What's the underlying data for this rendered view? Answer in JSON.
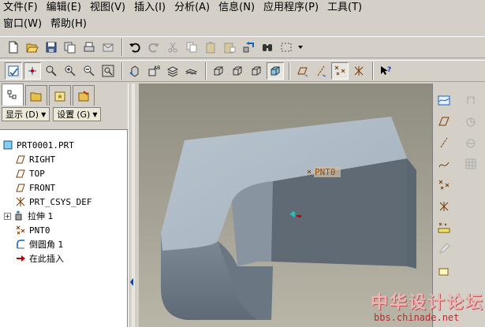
{
  "menu": {
    "row1": [
      "文件",
      "编辑",
      "视图",
      "插入",
      "分析",
      "信息",
      "应用程序",
      "工具"
    ],
    "row1_keys": [
      "(F)",
      "(E)",
      "(V)",
      "(I)",
      "(A)",
      "(N)",
      "(P)",
      "(T)"
    ],
    "row2": [
      "窗口",
      "帮助"
    ],
    "row2_keys": [
      "(W)",
      "(H)"
    ]
  },
  "panel": {
    "show_label": "显示",
    "show_key": "(D)",
    "settings_label": "设置",
    "settings_key": "(G)"
  },
  "tree": {
    "items": [
      {
        "label": "PRT0001.PRT",
        "icon": "part-icon"
      },
      {
        "label": "RIGHT",
        "icon": "datum-plane-icon"
      },
      {
        "label": "TOP",
        "icon": "datum-plane-icon"
      },
      {
        "label": "FRONT",
        "icon": "datum-plane-icon"
      },
      {
        "label": "PRT_CSYS_DEF",
        "icon": "csys-icon"
      },
      {
        "label": "拉伸 1",
        "icon": "extrude-icon"
      },
      {
        "label": "PNT0",
        "icon": "datum-point-icon"
      },
      {
        "label": "倒圆角 1",
        "icon": "round-icon"
      },
      {
        "label": "在此插入",
        "icon": "insert-here-arrow-icon"
      }
    ]
  },
  "viewport": {
    "point_label": "PNT0"
  },
  "watermark": {
    "title": "中华设计论坛",
    "url": "bbs.chinade.net"
  },
  "colors": {
    "model_top": "#a8b4c0",
    "model_front": "#6e7a86",
    "pocket_floor": "#5f6a74",
    "accent_red": "#c00000"
  }
}
